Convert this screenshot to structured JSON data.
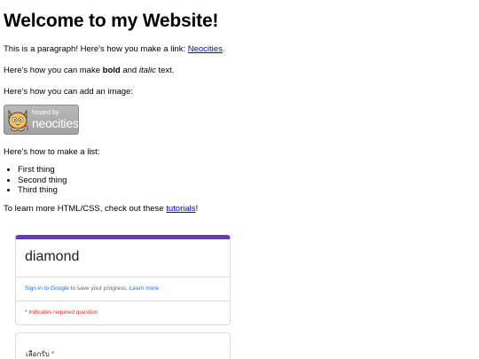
{
  "heading": "Welcome to my Website!",
  "para1": {
    "text": "This is a paragraph! Here's how you make a link: ",
    "link": "Neocities",
    "after": "."
  },
  "para2": {
    "before": "Here's how you can make ",
    "bold": "bold",
    "mid": " and ",
    "italic": "italic",
    "after": " text."
  },
  "para3": "Here's how you can add an image:",
  "badge": {
    "small": "hosted by",
    "big": "neocities",
    "icon": "neocities-cat-icon"
  },
  "para4": "Here's how to make a list:",
  "list": [
    "First thing",
    "Second thing",
    "Third thing"
  ],
  "para5": {
    "before": "To learn more HTML/CSS, check out these ",
    "link": "tutorials",
    "after": "!"
  },
  "form": {
    "title": "diamond",
    "signin_link": "Sign in to Google",
    "signin_rest": " to save your progress. ",
    "learn_more": "Learn more",
    "required_note": "* Indicates required question",
    "question_label": "เลือกรับ",
    "question_star": "*"
  },
  "colors": {
    "form_accent": "#673ab7",
    "link": "#0000ee",
    "google_blue": "#1a73e8",
    "required_red": "#d93025"
  }
}
